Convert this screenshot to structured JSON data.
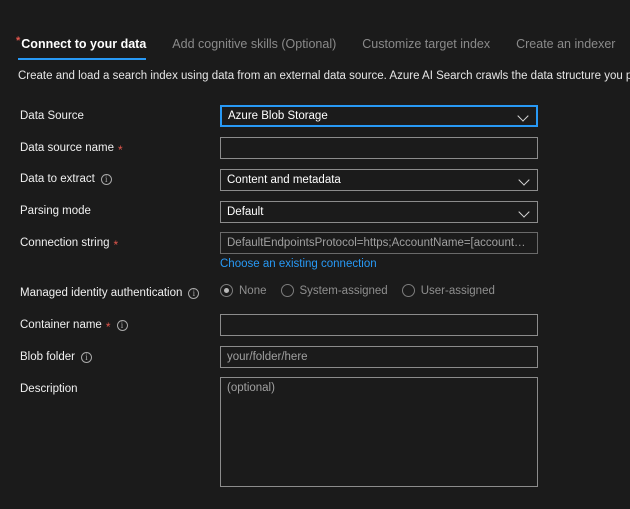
{
  "wizard": {
    "tabs": [
      {
        "label": "Connect to your data",
        "required": true,
        "active": true
      },
      {
        "label": "Add cognitive skills (Optional)",
        "required": false,
        "active": false
      },
      {
        "label": "Customize target index",
        "required": false,
        "active": false
      },
      {
        "label": "Create an indexer",
        "required": false,
        "active": false
      }
    ],
    "intro": "Create and load a search index using data from an external data source. Azure AI Search crawls the data structure you provide, extract",
    "required_marker": "*"
  },
  "form": {
    "data_source": {
      "label": "Data Source",
      "value": "Azure Blob Storage",
      "control": "dropdown",
      "focused": true
    },
    "data_source_name": {
      "label": "Data source name",
      "value": "",
      "placeholder": "",
      "required": true,
      "control": "text"
    },
    "data_to_extract": {
      "label": "Data to extract",
      "value": "Content and metadata",
      "control": "dropdown",
      "info": true
    },
    "parsing_mode": {
      "label": "Parsing mode",
      "value": "Default",
      "control": "dropdown"
    },
    "connection_string": {
      "label": "Connection string",
      "placeholder": "DefaultEndpointsProtocol=https;AccountName=[accountName];...",
      "value": "",
      "required": true,
      "control": "text",
      "link_label": "Choose an existing connection"
    },
    "managed_identity": {
      "label": "Managed identity authentication",
      "info": true,
      "options": [
        {
          "label": "None",
          "selected": true
        },
        {
          "label": "System-assigned",
          "selected": false
        },
        {
          "label": "User-assigned",
          "selected": false
        }
      ]
    },
    "container_name": {
      "label": "Container name",
      "value": "",
      "placeholder": "",
      "required": true,
      "info": true,
      "control": "text"
    },
    "blob_folder": {
      "label": "Blob folder",
      "placeholder": "your/folder/here",
      "value": "",
      "info": true,
      "control": "text"
    },
    "description": {
      "label": "Description",
      "placeholder": "(optional)",
      "value": "",
      "control": "textarea"
    }
  },
  "colors": {
    "background": "#1b1b1b",
    "accent_blue": "#2899f5",
    "required_red": "#e2564c",
    "border": "#8c8c8c",
    "muted_text": "#8a8a8a"
  }
}
